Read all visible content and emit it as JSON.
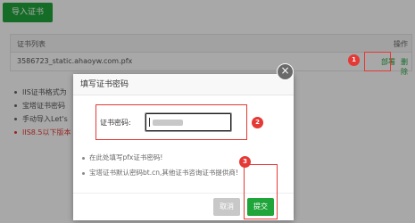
{
  "toolbar": {
    "import_label": "导入证书"
  },
  "cert_table": {
    "headers": {
      "name": "证书列表",
      "operation": "操作"
    },
    "rows": [
      {
        "name": "3586723_static.ahaoyw.com.pfx",
        "deploy_label": "部署",
        "delete_label": "删除"
      }
    ]
  },
  "page_tips": [
    "IIS证书格式为",
    "宝塔证书密码",
    "手动导入Let's",
    "IIS8.5以下版本"
  ],
  "dialog": {
    "title": "填写证书密码",
    "close_glyph": "×",
    "password_label": "证书密码:",
    "password_value": "",
    "tips": [
      "在此处填写pfx证书密码!",
      "宝塔证书默认密码bt.cn,其他证书咨询证书提供商!"
    ],
    "cancel_label": "取消",
    "submit_label": "提交"
  },
  "annotations": {
    "step1": "1",
    "step2": "2",
    "step3": "3"
  },
  "colors": {
    "accent": "#20a53a",
    "highlight": "#e53935",
    "overlay": "#a8a8a8"
  }
}
